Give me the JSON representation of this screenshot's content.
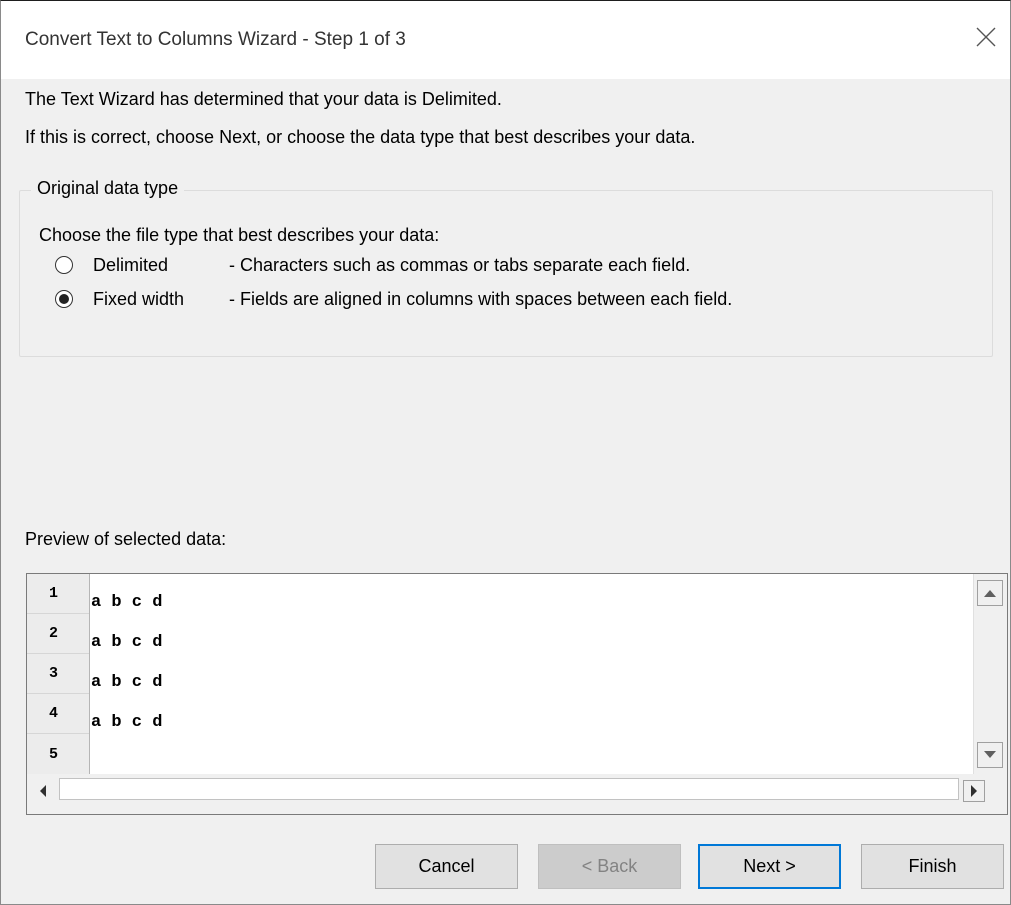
{
  "window": {
    "title": "Convert Text to Columns Wizard - Step 1 of 3",
    "close_icon": "close-icon"
  },
  "intro": {
    "line1": "The Text Wizard has determined that your data is Delimited.",
    "line2": "If this is correct, choose Next, or choose the data type that best describes your data."
  },
  "original_data_type": {
    "legend": "Original data type",
    "prompt": "Choose the file type that best describes your data:",
    "options": [
      {
        "label": "Delimited",
        "description": "- Characters such as commas or tabs separate each field.",
        "selected": false
      },
      {
        "label": "Fixed width",
        "description": "- Fields are aligned in columns with spaces between each field.",
        "selected": true
      }
    ]
  },
  "preview": {
    "label": "Preview of selected data:",
    "rows": [
      {
        "num": "1",
        "text": "a b c d"
      },
      {
        "num": "2",
        "text": "a b c d"
      },
      {
        "num": "3",
        "text": "a b c d"
      },
      {
        "num": "4",
        "text": "a b c d"
      },
      {
        "num": "5",
        "text": ""
      }
    ]
  },
  "buttons": {
    "cancel": "Cancel",
    "back": "< Back",
    "next": "Next >",
    "finish": "Finish"
  }
}
